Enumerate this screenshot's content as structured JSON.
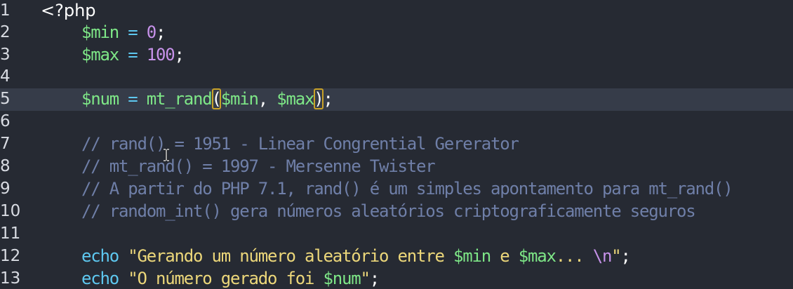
{
  "editor": {
    "language": "php",
    "current_line": 5,
    "colors": {
      "background": "#262a33",
      "current_line_background": "#363c49",
      "variable": "#7ee787",
      "operator": "#5ec8f0",
      "number": "#c792ea",
      "comment": "#6f7fa8",
      "string": "#ecd77a",
      "bracket_match": "#c9a227"
    },
    "lines": [
      {
        "number": "1",
        "tokens": {
          "open_tag": "<?php"
        }
      },
      {
        "number": "2",
        "tokens": {
          "var": "$min",
          "op": " = ",
          "num": "0",
          "end": ";"
        }
      },
      {
        "number": "3",
        "tokens": {
          "var": "$max",
          "op": " = ",
          "num": "100",
          "end": ";"
        }
      },
      {
        "number": "4",
        "tokens": {}
      },
      {
        "number": "5",
        "tokens": {
          "var": "$num",
          "op": " = ",
          "fn": "mt_rand",
          "lparen": "(",
          "arg1": "$min",
          "comma": ", ",
          "arg2": "$max",
          "rparen": ")",
          "end": ";"
        }
      },
      {
        "number": "6",
        "tokens": {}
      },
      {
        "number": "7",
        "tokens": {
          "comment": "// rand() = 1951 - Linear Congrential Gererator"
        }
      },
      {
        "number": "8",
        "tokens": {
          "comment": "// mt_rand() = 1997 - Mersenne Twister"
        }
      },
      {
        "number": "9",
        "tokens": {
          "comment": "// A partir do PHP 7.1, rand() é um simples apontamento para mt_rand()"
        }
      },
      {
        "number": "10",
        "tokens": {
          "comment": "// random_int() gera números aleatórios criptograficamente seguros"
        }
      },
      {
        "number": "11",
        "tokens": {}
      },
      {
        "number": "12",
        "tokens": {
          "kw": "echo",
          "sp": " ",
          "s1": "\"Gerando um número aleatório entre ",
          "v1": "$min",
          "s2": " e ",
          "v2": "$max",
          "s3": "... ",
          "esc": "\\n",
          "s4": "\"",
          "end": ";"
        }
      },
      {
        "number": "13",
        "tokens": {
          "kw": "echo",
          "sp": " ",
          "s1": "\"O número gerado foi ",
          "v1": "$num",
          "s4": "\"",
          "end": ";"
        }
      }
    ]
  }
}
